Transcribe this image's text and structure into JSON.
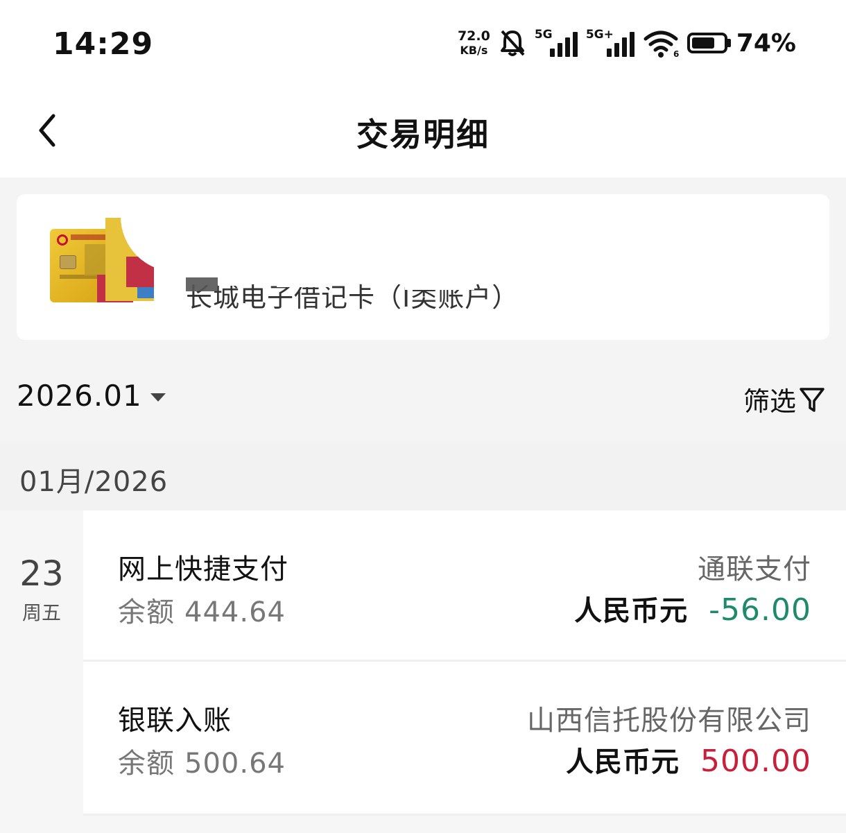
{
  "status_bar": {
    "time": "14:29",
    "net_speed_value": "72.0",
    "net_speed_unit": "KB/s",
    "signal1_label": "5G",
    "signal2_label": "5G+",
    "battery_percent": "74%",
    "battery_level": 0.74,
    "icons": [
      "bell-muted-icon",
      "signal-icon",
      "signal-icon",
      "wifi-icon",
      "battery-icon"
    ]
  },
  "header": {
    "title": "交易明细",
    "back_icon": "chevron-left-icon"
  },
  "account": {
    "name": "长城电子借记卡（I类账户）"
  },
  "filter": {
    "month": "2026.01",
    "filter_label": "筛选",
    "filter_icon": "funnel-icon"
  },
  "month_header": "01月/2026",
  "day_group": {
    "day": "23",
    "weekday": "周五"
  },
  "transactions": [
    {
      "type": "网上快捷支付",
      "balance_label": "余额",
      "balance": "444.64",
      "counterparty": "通联支付",
      "currency": "人民币元",
      "amount": "-56.00",
      "amount_color": "#1e8a6b"
    },
    {
      "type": "银联入账",
      "balance_label": "余额",
      "balance": "500.64",
      "counterparty": "山西信托股份有限公司",
      "currency": "人民币元",
      "amount": "500.00",
      "amount_color": "#c8203a"
    }
  ]
}
